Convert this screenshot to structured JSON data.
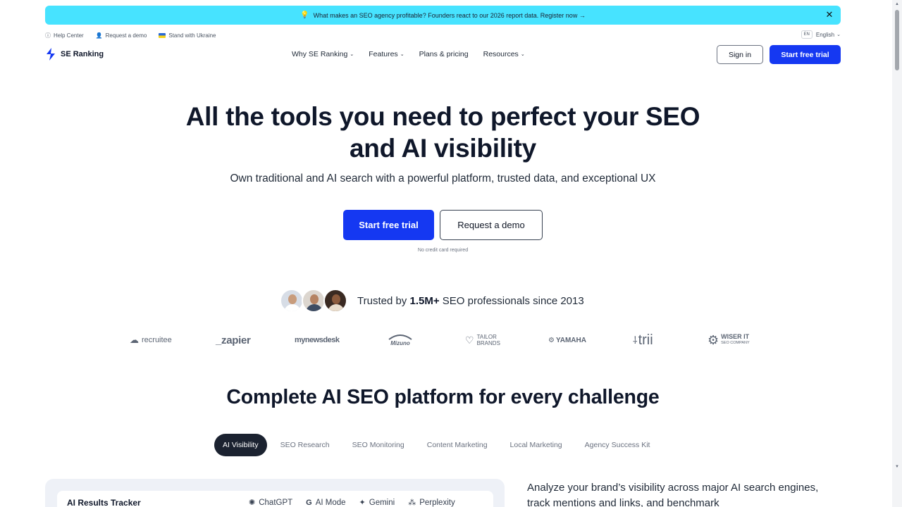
{
  "banner": {
    "text": "What makes an SEO agency profitable? Founders react to our 2026 report data. Register now →",
    "icon": "lightbulb-icon",
    "background": "#47e3ff"
  },
  "utility": {
    "help": "Help Center",
    "demo": "Request a demo",
    "ukraine": "Stand with Ukraine",
    "lang_code": "EN",
    "lang_label": "English"
  },
  "nav": {
    "brand": "SE Ranking",
    "items": [
      "Why SE Ranking",
      "Features",
      "Plans & pricing",
      "Resources"
    ],
    "sign_in": "Sign in",
    "start_trial": "Start free trial"
  },
  "hero": {
    "title_line1": "All the tools you need to perfect your SEO",
    "title_line2": "and AI visibility",
    "subtitle": "Own traditional and AI search with a powerful platform, trusted data, and exceptional UX",
    "primary_button": "Start free trial",
    "secondary_button": "Request a demo",
    "note": "No credit card required"
  },
  "trust": {
    "prefix": "Trusted by ",
    "highlight": "1.5M+",
    "suffix": " SEO professionals since 2013"
  },
  "logos": {
    "recruitee": "recruitee",
    "zapier": "_zapier",
    "mynewsdesk": "mynewsdesk",
    "mizuno": "Mizuno",
    "tailor_top": "TAILOR",
    "tailor_bottom": "BRANDS",
    "yamaha": "YAMAHA",
    "trii": "trii",
    "wiser_top": "WISER IT",
    "wiser_bottom": "SEO COMPANY"
  },
  "section": {
    "title": "Complete AI SEO platform for every challenge",
    "tabs": [
      "AI Visibility",
      "SEO Research",
      "SEO Monitoring",
      "Content Marketing",
      "Local Marketing",
      "Agency Success Kit"
    ],
    "active_tab": "AI Visibility"
  },
  "tracker": {
    "title": "AI Results Tracker",
    "engines": [
      "ChatGPT",
      "AI Mode",
      "Gemini",
      "Perplexity"
    ]
  },
  "side_text": "Analyze your brand’s visibility across major AI search engines, track mentions and links, and benchmark",
  "colors": {
    "accent": "#1538f2",
    "dark": "#0f172a",
    "banner": "#47e3ff"
  }
}
